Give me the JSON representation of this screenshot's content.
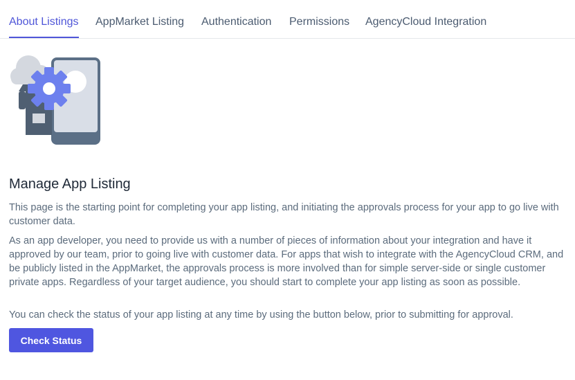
{
  "tabs": [
    {
      "label": "About Listings",
      "active": true
    },
    {
      "label": "AppMarket Listing",
      "active": false
    },
    {
      "label": "Authentication",
      "active": false
    },
    {
      "label": "Permissions",
      "active": false
    },
    {
      "label": "AgencyCloud Integration",
      "active": false
    }
  ],
  "illustration": {
    "icons": [
      "cloud-icon",
      "storefront-icon",
      "gear-icon",
      "phone-icon"
    ],
    "colors": {
      "accent": "#6d80ee",
      "phone_frame": "#5b6f86",
      "phone_screen": "#d9dee7",
      "cloud": "#d4d8df",
      "store": "#4f5f72"
    }
  },
  "main": {
    "heading": "Manage App Listing",
    "paragraphs": [
      "This page is the starting point for completing your app listing, and initiating the approvals process for your app to go live with customer data.",
      "As an app developer, you need to provide us with a number of pieces of information about your integration and have it approved by our team, prior to going live with customer data. For apps that wish to integrate with the AgencyCloud CRM, and be publicly listed in the AppMarket, the approvals process is more involved than for simple server-side or single customer private apps. Regardless of your target audience, you should start to complete your app listing as soon as possible.",
      "You can check the status of your app listing at any time by using the button below, prior to submitting for approval."
    ],
    "check_status_label": "Check Status"
  },
  "colors": {
    "accent": "#4f56d8",
    "button_bg": "#4f56e0",
    "text": "#5b6b7c",
    "heading": "#1f2937"
  }
}
